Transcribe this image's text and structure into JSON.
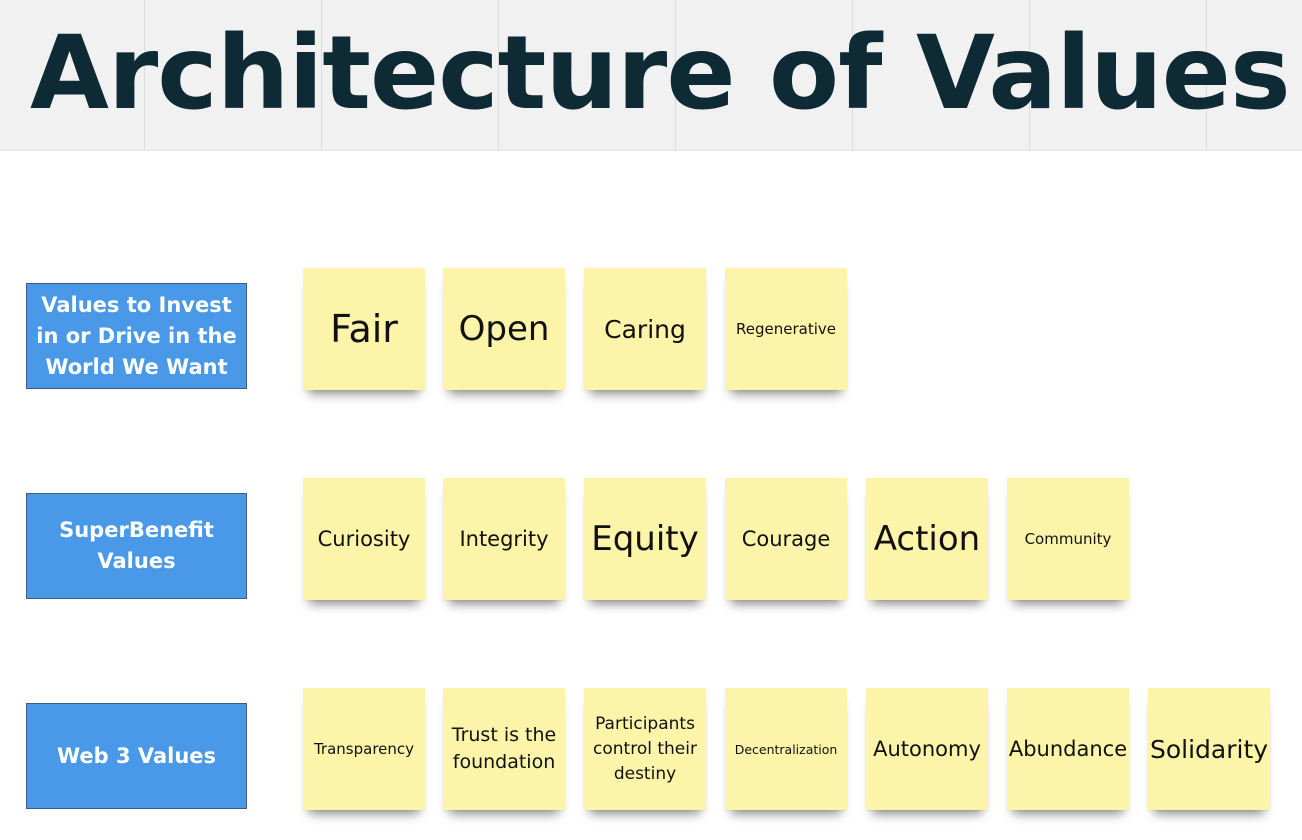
{
  "title": "Architecture of Values",
  "rows": [
    {
      "label": "Values to Invest in or Drive in the World We Want",
      "notes": [
        "Fair",
        "Open",
        "Caring",
        "Regenerative"
      ]
    },
    {
      "label": "SuperBenefit Values",
      "notes": [
        "Curiosity",
        "Integrity",
        "Equity",
        "Courage",
        "Action",
        "Community"
      ]
    },
    {
      "label": "Web 3 Values",
      "notes": [
        "Transparency",
        "Trust is the foundation",
        "Participants control their destiny",
        "Decentralization",
        "Autonomy",
        "Abundance",
        "Solidarity"
      ]
    }
  ],
  "colors": {
    "header_background": "#f1f1f1",
    "title": "#0e2b35",
    "label_box": "#4a98e8",
    "sticky_note": "#fcf4a9"
  }
}
